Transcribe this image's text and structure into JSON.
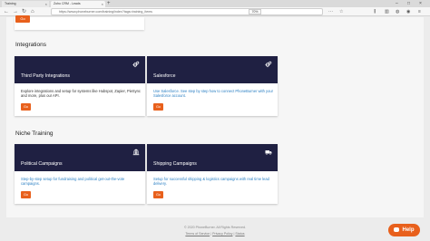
{
  "browser": {
    "tabs": [
      {
        "label": "Training"
      },
      {
        "label": "Zoho CRM - Leads"
      }
    ],
    "url": "https://www.phoneburner.com/training/index?tags=training_items",
    "zoom": "70%"
  },
  "page": {
    "top_button_label": "Go",
    "sections": [
      {
        "title": "Integrations",
        "cards": [
          {
            "title": "Third Party Integrations",
            "icon": "gears-icon",
            "description": "Explore integrations and setup for systems like Hubspot, Zapier, PieSync and more, plus our API.",
            "desc_style": "dark",
            "button": "Go"
          },
          {
            "title": "Salesforce",
            "icon": "gears-icon",
            "description": "Use Salesforce. See step by step how to connect PhoneBurner with your Salesforce account.",
            "desc_style": "blue",
            "button": "Go"
          }
        ]
      },
      {
        "title": "Niche Training",
        "cards": [
          {
            "title": "Political Campaigns",
            "icon": "capitol-building-icon",
            "description": "Step-by-step setup for fundraising and political get-out-the-vote campaigns.",
            "desc_style": "blue",
            "button": "Go"
          },
          {
            "title": "Shipping Campaigns",
            "icon": "truck-icon",
            "description": "Setup for successful shipping & logistics campaigns with real time lead delivery.",
            "desc_style": "blue",
            "button": "Go"
          }
        ]
      }
    ]
  },
  "footer": {
    "copyright": "© 2020 PhoneBurner. All Rights Reserved.",
    "links": [
      "Terms of Service",
      "Privacy Policy",
      "Status"
    ],
    "separator": "|"
  },
  "help_button": {
    "label": "Help"
  },
  "colors": {
    "accent": "#e8601c",
    "card_header": "#1f2042",
    "link_blue": "#2a7fc3"
  }
}
